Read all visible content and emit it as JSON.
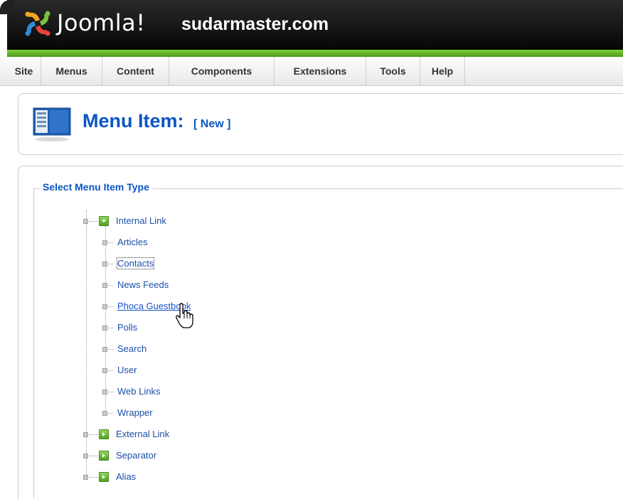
{
  "header": {
    "brand": "Joomla!",
    "site_name": "sudarmaster.com"
  },
  "menu": [
    {
      "label": "Site"
    },
    {
      "label": "Menus"
    },
    {
      "label": "Content"
    },
    {
      "label": "Components"
    },
    {
      "label": "Extensions"
    },
    {
      "label": "Tools"
    },
    {
      "label": "Help"
    }
  ],
  "page": {
    "title": "Menu Item:",
    "tag": "[ New ]"
  },
  "panel": {
    "legend": "Select Menu Item Type"
  },
  "tree": {
    "internal": "Internal Link",
    "children": [
      {
        "label": "Articles"
      },
      {
        "label": "Contacts"
      },
      {
        "label": "News Feeds"
      },
      {
        "label": "Phoca Guestbook"
      },
      {
        "label": "Polls"
      },
      {
        "label": "Search"
      },
      {
        "label": "User"
      },
      {
        "label": "Web Links"
      },
      {
        "label": "Wrapper"
      }
    ],
    "external": "External Link",
    "separator": "Separator",
    "alias": "Alias"
  },
  "colors": {
    "header_bg": "#000000",
    "accent_green": "#6cbf2c",
    "link_blue": "#0b55c4"
  }
}
